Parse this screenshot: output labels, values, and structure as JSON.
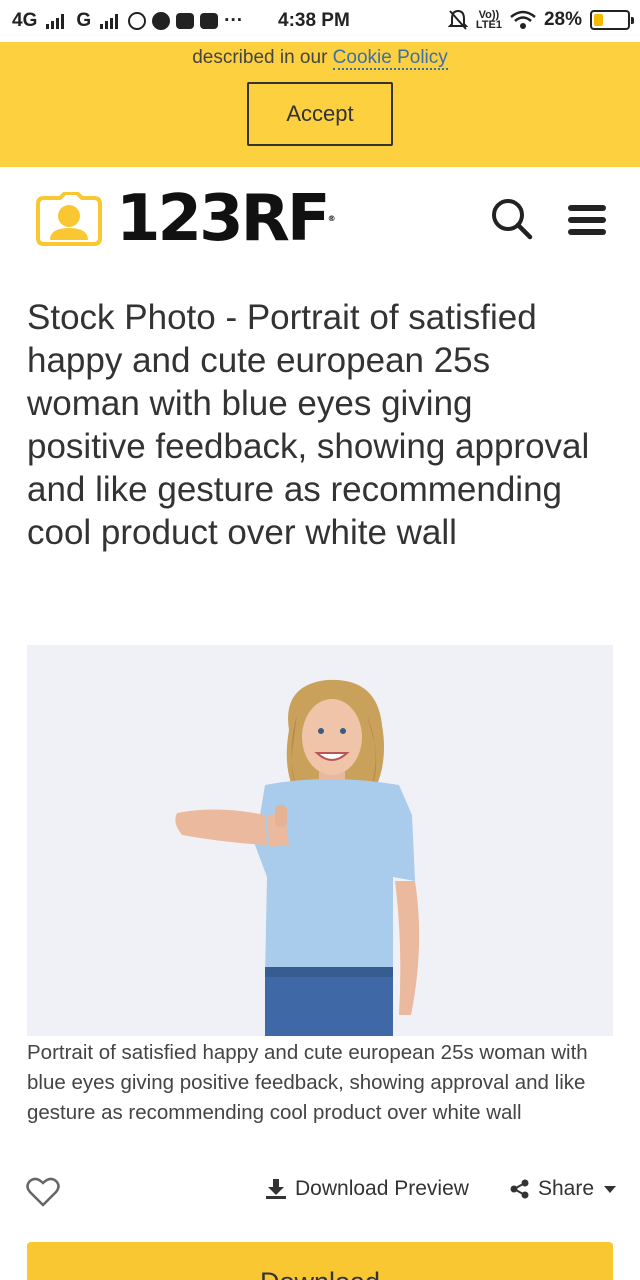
{
  "status_bar": {
    "network_1": "4G",
    "network_2": "G",
    "dots": "···",
    "time": "4:38 PM",
    "volte_top": "Vo))",
    "volte_bottom": "LTE1",
    "battery_percent": "28%",
    "battery_level": 0.28
  },
  "cookie_banner": {
    "text": "described in our ",
    "link": "Cookie Policy",
    "accept_label": "Accept"
  },
  "header": {
    "brand": "123RF",
    "brand_mark": "®",
    "icons": [
      "camera-logo-icon",
      "search-icon",
      "hamburger-menu-icon"
    ]
  },
  "photo": {
    "title": "Stock Photo - Portrait of satisfied happy and cute european 25s woman with blue eyes giving positive feedback, showing approval and like gesture as recommending cool product over white wall",
    "caption": "Portrait of satisfied happy and cute european 25s woman with blue eyes giving positive feedback, showing approval and like gesture as recommending cool product over white wall"
  },
  "actions": {
    "download_preview": "Download Preview",
    "share": "Share",
    "download": "Download"
  },
  "colors": {
    "banner": "#fcd03f",
    "download_button": "#f9c731",
    "logo_accent": "#f9c731"
  }
}
